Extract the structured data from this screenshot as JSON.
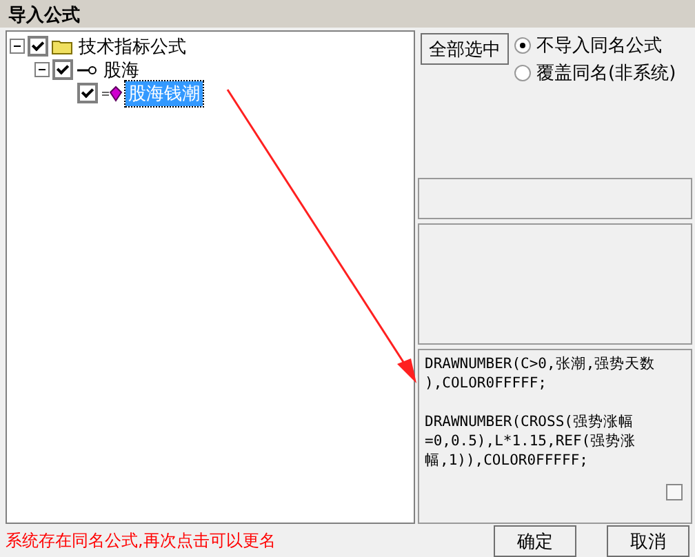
{
  "window": {
    "title": "导入公式"
  },
  "tree": [
    {
      "label": "技术指标公式",
      "kind": "folder",
      "checked": true,
      "expanded": true,
      "selected": false,
      "children": [
        {
          "label": "股海",
          "kind": "key",
          "checked": true,
          "expanded": true,
          "selected": false,
          "children": [
            {
              "label": "股海钱潮",
              "kind": "formula",
              "checked": true,
              "selected": true
            }
          ]
        }
      ]
    }
  ],
  "select_all_button": "全部选中",
  "options": [
    {
      "label": "不导入同名公式",
      "selected": true
    },
    {
      "label": "覆盖同名(非系统)",
      "selected": false
    }
  ],
  "code_blocks": [
    [
      "DRAWNUMBER(C>0,张潮,强势天数",
      "),COLOR0FFFFF;"
    ],
    [
      "DRAWNUMBER(CROSS(强势涨幅",
      "=0,0.5),L*1.15,REF(强势涨",
      "幅,1)),COLOR0FFFFF;"
    ]
  ],
  "code_checkbox": {
    "checked": false
  },
  "status": "系统存在同名公式,再次点击可以更名",
  "buttons": [
    "确定",
    "取消"
  ]
}
